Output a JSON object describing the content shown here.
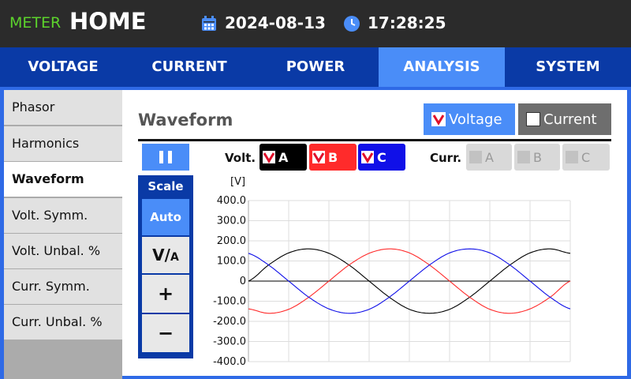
{
  "header": {
    "brand_small": "METER",
    "brand_big": "HOME",
    "date": "2024-08-13",
    "time": "17:28:25"
  },
  "tabs": [
    {
      "label": "VOLTAGE",
      "active": false
    },
    {
      "label": "CURRENT",
      "active": false
    },
    {
      "label": "POWER",
      "active": false
    },
    {
      "label": "ANALYSIS",
      "active": true
    },
    {
      "label": "SYSTEM",
      "active": false
    }
  ],
  "sidebar": {
    "items": [
      {
        "label": "Phasor",
        "active": false
      },
      {
        "label": "Harmonics",
        "active": false
      },
      {
        "label": "Waveform",
        "active": true
      },
      {
        "label": "Volt. Symm.",
        "active": false
      },
      {
        "label": "Volt. Unbal. %",
        "active": false
      },
      {
        "label": "Curr. Symm.",
        "active": false
      },
      {
        "label": "Curr. Unbal. %",
        "active": false
      }
    ]
  },
  "panel": {
    "title": "Waveform",
    "voltage_toggle": {
      "label": "Voltage",
      "checked": true
    },
    "current_toggle": {
      "label": "Current",
      "checked": false
    }
  },
  "scale": {
    "title": "Scale",
    "auto": "Auto",
    "unit_main": "V",
    "unit_sub": "A",
    "plus": "+",
    "minus": "−"
  },
  "phases": {
    "volt_label": "Volt.",
    "curr_label": "Curr.",
    "volt": [
      {
        "label": "A",
        "checked": true,
        "color": "#000000"
      },
      {
        "label": "B",
        "checked": true,
        "color": "#ff2b2b"
      },
      {
        "label": "C",
        "checked": true,
        "color": "#1010e8"
      }
    ],
    "curr": [
      {
        "label": "A",
        "enabled": false
      },
      {
        "label": "B",
        "enabled": false
      },
      {
        "label": "C",
        "enabled": false
      }
    ]
  },
  "chart_data": {
    "type": "line",
    "unit": "[V]",
    "ylim": [
      -400,
      400
    ],
    "yticks": [
      400,
      300,
      200,
      100,
      0,
      -100,
      -200,
      -300,
      -400
    ],
    "ytick_labels": [
      "400.0",
      "300.0",
      "200.0",
      "100.0",
      "0",
      "-100.0",
      "-200.0",
      "-300.0",
      "-400.0"
    ],
    "grid": true,
    "x": [
      0,
      5,
      10,
      15,
      20,
      25,
      30,
      35,
      40,
      45,
      50,
      55,
      60,
      65,
      70,
      75,
      80
    ],
    "series": [
      {
        "color": "#000000",
        "values": [
          0,
          80,
          140,
          160,
          138,
          80,
          0,
          -80,
          -140,
          -160,
          -140,
          -80,
          0,
          80,
          140,
          160,
          138
        ]
      },
      {
        "color": "#ff2b2b",
        "values": [
          -138,
          -160,
          -140,
          -80,
          0,
          80,
          138,
          160,
          140,
          80,
          0,
          -80,
          -140,
          -160,
          -138,
          -80,
          0
        ]
      },
      {
        "color": "#1010e8",
        "values": [
          138,
          80,
          0,
          -80,
          -138,
          -160,
          -140,
          -80,
          0,
          80,
          140,
          160,
          140,
          80,
          0,
          -80,
          -138
        ]
      }
    ]
  },
  "colors": {
    "accent": "#4a8df8",
    "nav": "#0a3aa6",
    "header": "#2b2b2b",
    "brand": "#5cd32c"
  }
}
